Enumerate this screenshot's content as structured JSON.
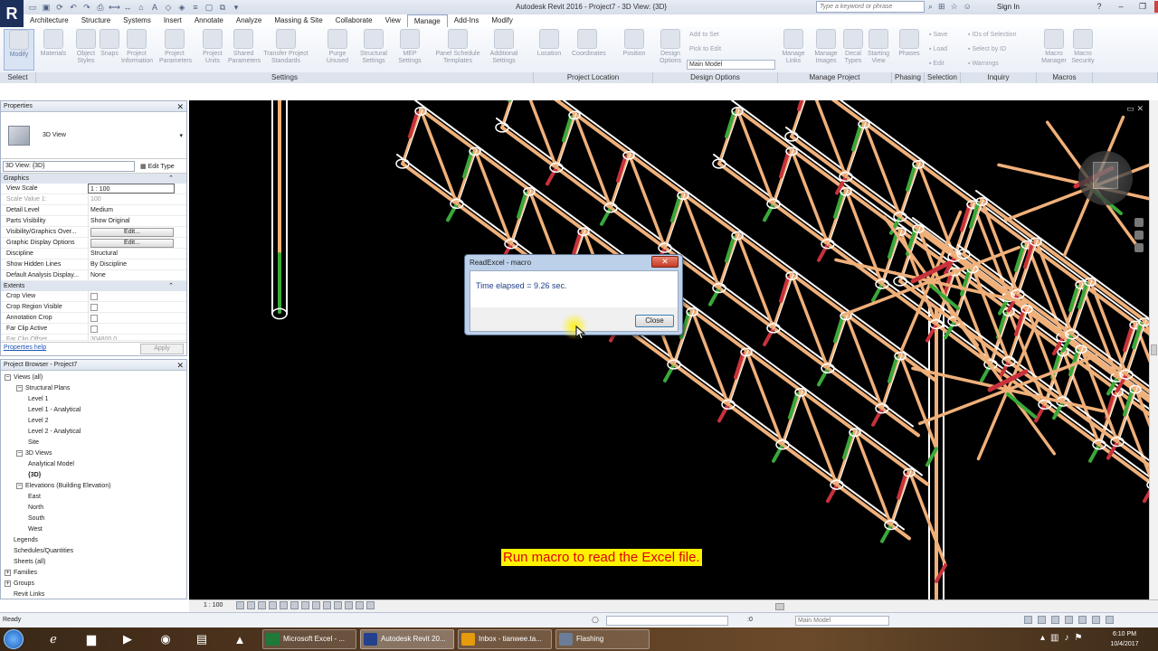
{
  "app": {
    "logo": "R",
    "title": "Autodesk Revit 2016 -    Project7 - 3D View: {3D}",
    "search_placeholder": "Type a keyword or phrase",
    "signin": "Sign In"
  },
  "menu_tabs": [
    "Architecture",
    "Structure",
    "Systems",
    "Insert",
    "Annotate",
    "Analyze",
    "Massing & Site",
    "Collaborate",
    "View",
    "Manage",
    "Add-Ins",
    "Modify"
  ],
  "active_tab": "Manage",
  "ribbon": {
    "buttons": [
      {
        "label": "Modify"
      },
      {
        "label": "Materials"
      },
      {
        "label": "Object Styles"
      },
      {
        "label": "Snaps"
      },
      {
        "label": "Project Information"
      },
      {
        "label": "Project Parameters"
      },
      {
        "label": "Project Units"
      },
      {
        "label": "Shared Parameters"
      },
      {
        "label": "Transfer Project Standards"
      },
      {
        "label": "Purge Unused"
      },
      {
        "label": "Structural Settings"
      },
      {
        "label": "MEP Settings"
      },
      {
        "label": "Panel Schedule Templates"
      },
      {
        "label": "Additional Settings"
      },
      {
        "label": "Location"
      },
      {
        "label": "Coordinates"
      },
      {
        "label": "Position"
      },
      {
        "label": "Design Options"
      },
      {
        "label": "Manage Links"
      },
      {
        "label": "Manage Images"
      },
      {
        "label": "Decal Types"
      },
      {
        "label": "Starting View"
      },
      {
        "label": "Phases"
      },
      {
        "label": "Macro Manager"
      },
      {
        "label": "Macro Security"
      }
    ],
    "small_buttons": {
      "add_to_set": "Add to Set",
      "pick_to_edit": "Pick to Edit",
      "save": "Save",
      "load": "Load",
      "edit": "Edit",
      "ids_of_selection": "IDs of Selection",
      "select_by_id": "Select by ID",
      "warnings": "Warnings"
    },
    "design_option_value": "Main Model",
    "panels": [
      "Select",
      "Settings",
      "Project Location",
      "Design Options",
      "Manage Project",
      "Phasing",
      "Selection",
      "Inquiry",
      "Macros"
    ]
  },
  "properties": {
    "title": "Properties",
    "type_name": "3D View",
    "view_selector": "3D View: {3D}",
    "edit_type": "Edit Type",
    "groups": {
      "graphics": "Graphics",
      "extents": "Extents"
    },
    "graphics_rows": [
      {
        "k": "View Scale",
        "v": "1 : 100"
      },
      {
        "k": "Scale Value    1:",
        "v": "100"
      },
      {
        "k": "Detail Level",
        "v": "Medium"
      },
      {
        "k": "Parts Visibility",
        "v": "Show Original"
      },
      {
        "k": "Visibility/Graphics Over...",
        "v": "Edit..."
      },
      {
        "k": "Graphic Display Options",
        "v": "Edit..."
      },
      {
        "k": "Discipline",
        "v": "Structural"
      },
      {
        "k": "Show Hidden Lines",
        "v": "By Discipline"
      },
      {
        "k": "Default Analysis Display...",
        "v": "None"
      }
    ],
    "extents_rows": [
      {
        "k": "Crop View"
      },
      {
        "k": "Crop Region Visible"
      },
      {
        "k": "Annotation Crop"
      },
      {
        "k": "Far Clip Active"
      },
      {
        "k": "Far Clip Offset",
        "v": "304800.0"
      }
    ],
    "help": "Properties help",
    "apply": "Apply"
  },
  "browser": {
    "title": "Project Browser - Project7",
    "items": [
      {
        "label": "Views (all)",
        "level": 0,
        "toggle": "−"
      },
      {
        "label": "Structural Plans",
        "level": 1,
        "toggle": "−"
      },
      {
        "label": "Level 1",
        "level": 2
      },
      {
        "label": "Level 1 - Analytical",
        "level": 2
      },
      {
        "label": "Level 2",
        "level": 2
      },
      {
        "label": "Level 2 - Analytical",
        "level": 2
      },
      {
        "label": "Site",
        "level": 2
      },
      {
        "label": "3D Views",
        "level": 1,
        "toggle": "−"
      },
      {
        "label": "Analytical Model",
        "level": 2
      },
      {
        "label": "{3D}",
        "level": 2,
        "selected": true
      },
      {
        "label": "Elevations (Building Elevation)",
        "level": 1,
        "toggle": "−"
      },
      {
        "label": "East",
        "level": 2
      },
      {
        "label": "North",
        "level": 2
      },
      {
        "label": "South",
        "level": 2
      },
      {
        "label": "West",
        "level": 2
      },
      {
        "label": "Legends",
        "level": 0
      },
      {
        "label": "Schedules/Quantities",
        "level": 0
      },
      {
        "label": "Sheets (all)",
        "level": 0
      },
      {
        "label": "Families",
        "level": 0,
        "toggle": "+"
      },
      {
        "label": "Groups",
        "level": 0,
        "toggle": "+"
      },
      {
        "label": "Revit Links",
        "level": 0
      }
    ]
  },
  "dialog": {
    "title": "ReadExcel - macro",
    "message": "Time elapsed = 9.26 sec.",
    "close_button": "Close"
  },
  "caption": "Run macro to read the Excel file.",
  "viewbar": {
    "scale": "1 : 100"
  },
  "status": {
    "text": "Ready",
    "zero": ":0",
    "model": "Main Model"
  },
  "taskbar": {
    "tasks": [
      {
        "label": "Microsoft Excel - ...",
        "color": "#1f7a3a"
      },
      {
        "label": "Autodesk Revit 20...",
        "color": "#23418c",
        "active": true
      },
      {
        "label": "Inbox - tianwee.ta...",
        "color": "#e59b0c"
      },
      {
        "label": "Flashing",
        "color": "#6b7d99"
      }
    ],
    "time": "6:10 PM",
    "date": "10/4/2017"
  },
  "colors": {
    "beam_orange": "#f0b07a",
    "beam_red": "#c8323c",
    "beam_green": "#3aa83a",
    "caption_bg": "#fff200",
    "caption_fg": "#e0000a"
  }
}
